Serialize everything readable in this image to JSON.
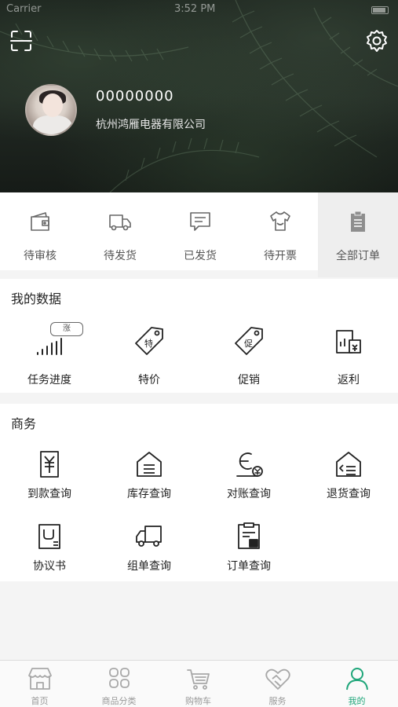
{
  "status_bar": {
    "carrier": "Carrier",
    "time": "3:52 PM"
  },
  "profile": {
    "name": "00000000",
    "company": "杭州鸿雁电器有限公司"
  },
  "orders": [
    {
      "label": "待审核",
      "icon": "wallet-icon"
    },
    {
      "label": "待发货",
      "icon": "truck-icon"
    },
    {
      "label": "已发货",
      "icon": "message-icon"
    },
    {
      "label": "待开票",
      "icon": "shirt-icon"
    },
    {
      "label": "全部订单",
      "icon": "clipboard-icon"
    }
  ],
  "my_data": {
    "title": "我的数据",
    "badge": "涨",
    "items": [
      {
        "label": "任务进度",
        "icon": "bar-progress-icon"
      },
      {
        "label": "特价",
        "icon": "tag-special-icon",
        "tag_text": "特"
      },
      {
        "label": "促销",
        "icon": "tag-promo-icon",
        "tag_text": "促"
      },
      {
        "label": "返利",
        "icon": "rebate-icon"
      }
    ]
  },
  "business": {
    "title": "商务",
    "items": [
      {
        "label": "到款查询",
        "icon": "payment-icon"
      },
      {
        "label": "库存查询",
        "icon": "warehouse-icon"
      },
      {
        "label": "对账查询",
        "icon": "reconcile-icon"
      },
      {
        "label": "退货查询",
        "icon": "return-icon"
      },
      {
        "label": "协议书",
        "icon": "agreement-icon"
      },
      {
        "label": "组单查询",
        "icon": "delivery-icon"
      },
      {
        "label": "订单查询",
        "icon": "order-icon"
      }
    ]
  },
  "tabs": [
    {
      "label": "首页",
      "icon": "home-store-icon",
      "active": false
    },
    {
      "label": "商品分类",
      "icon": "category-icon",
      "active": false
    },
    {
      "label": "购物车",
      "icon": "cart-icon",
      "active": false
    },
    {
      "label": "服务",
      "icon": "handshake-icon",
      "active": false
    },
    {
      "label": "我的",
      "icon": "user-icon",
      "active": true
    }
  ],
  "colors": {
    "accent": "#1fa67a",
    "header_bg": "#1e2520",
    "icon_gray": "#666666",
    "icon_dark": "#222222"
  }
}
